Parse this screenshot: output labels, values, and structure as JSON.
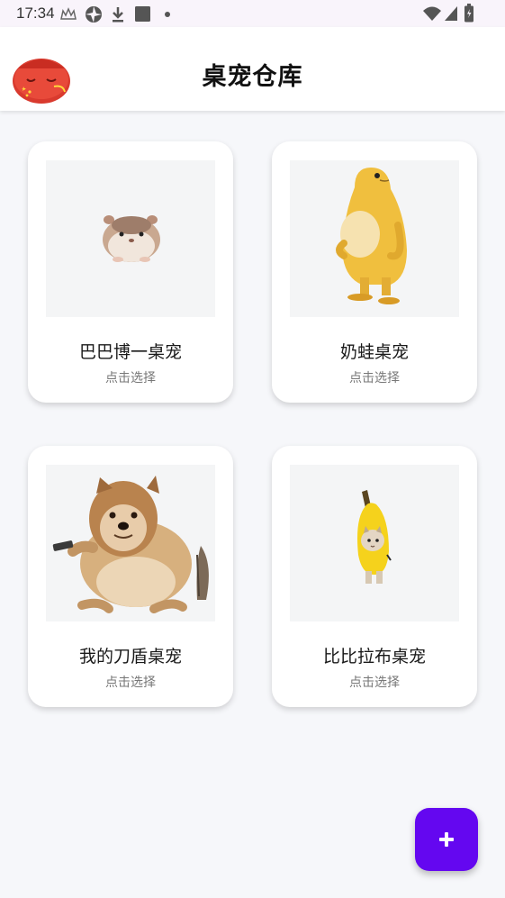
{
  "status_bar": {
    "time": "17:34",
    "icons": [
      "crown-icon",
      "vpn-icon",
      "download-icon",
      "square-icon",
      "dot-icon",
      "wifi-icon",
      "signal-icon",
      "battery-icon"
    ]
  },
  "app_bar": {
    "title": "桌宠仓库"
  },
  "pets": [
    {
      "name": "巴巴博一桌宠",
      "action": "点击选择",
      "image": "hamster-image"
    },
    {
      "name": "奶蛙桌宠",
      "action": "点击选择",
      "image": "yellow-frog-image"
    },
    {
      "name": "我的刀盾桌宠",
      "action": "点击选择",
      "image": "shiba-doge-image"
    },
    {
      "name": "比比拉布桌宠",
      "action": "点击选择",
      "image": "banana-cat-image"
    }
  ],
  "fab": {
    "icon": "plus-icon",
    "color": "#6407f0"
  },
  "colors": {
    "background": "#f6f7fa",
    "card": "#ffffff",
    "accent": "#6407f0"
  }
}
